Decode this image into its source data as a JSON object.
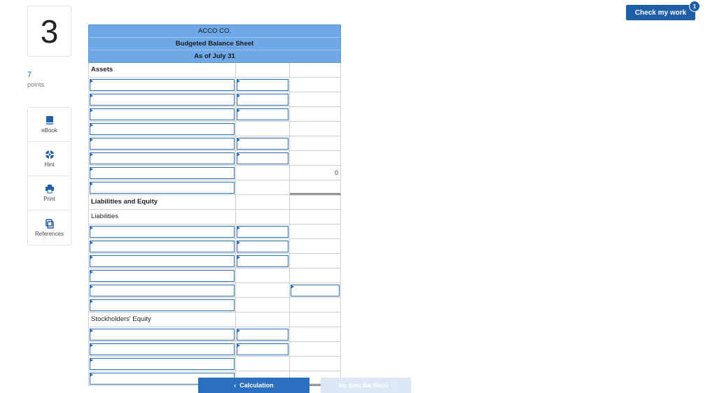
{
  "question": {
    "number": "3",
    "points_value": "7",
    "points_label": "points"
  },
  "tools": [
    {
      "label": "eBook",
      "icon": "book-icon"
    },
    {
      "label": "Hint",
      "icon": "lifebuoy-icon"
    },
    {
      "label": "Print",
      "icon": "printer-icon"
    },
    {
      "label": "References",
      "icon": "copy-icon"
    }
  ],
  "header": {
    "check_label": "Check my work",
    "badge_count": "1"
  },
  "sheet": {
    "company": "ACCO CO.",
    "title": "Budgeted Balance Sheet",
    "date": "As of July 31",
    "assets_label": "Assets",
    "total_assets_value": "0",
    "liab_equity_label": "Liabilities and Equity",
    "liabilities_label": "Liabilities",
    "equity_label": "Stockholders' Equity"
  },
  "nav": {
    "prev_label": "Calculation",
    "next_label": "Inc Stmt Bal Sheet"
  },
  "colors": {
    "accent": "#1f5fa8",
    "header_bg": "#6fa8e6",
    "input_border": "#2a6fb8"
  }
}
